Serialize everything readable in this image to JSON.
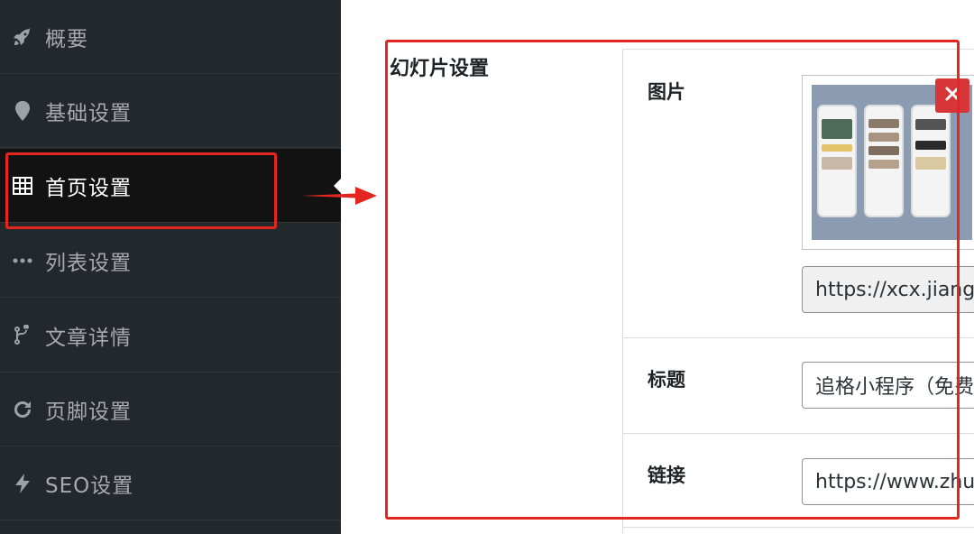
{
  "sidebar": {
    "items": [
      {
        "label": "概要",
        "icon": "rocket-icon"
      },
      {
        "label": "基础设置",
        "icon": "map-marker-icon"
      },
      {
        "label": "首页设置",
        "icon": "grid-icon",
        "active": true
      },
      {
        "label": "列表设置",
        "icon": "ellipsis-icon"
      },
      {
        "label": "文章详情",
        "icon": "branch-icon"
      },
      {
        "label": "页脚设置",
        "icon": "refresh-icon"
      },
      {
        "label": "SEO设置",
        "icon": "bolt-icon"
      }
    ]
  },
  "main": {
    "section_title": "幻灯片设置",
    "fields": {
      "image": {
        "label": "图片",
        "url_value": "https://xcx.jiangc"
      },
      "title": {
        "label": "标题",
        "value": "追格小程序（免费"
      },
      "link": {
        "label": "链接",
        "value": "https://www.zhu"
      }
    }
  },
  "colors": {
    "sidebar_bg": "#23282d",
    "active_bg": "#121212",
    "annotation_red": "#e3261f",
    "delete_red": "#d63638"
  }
}
